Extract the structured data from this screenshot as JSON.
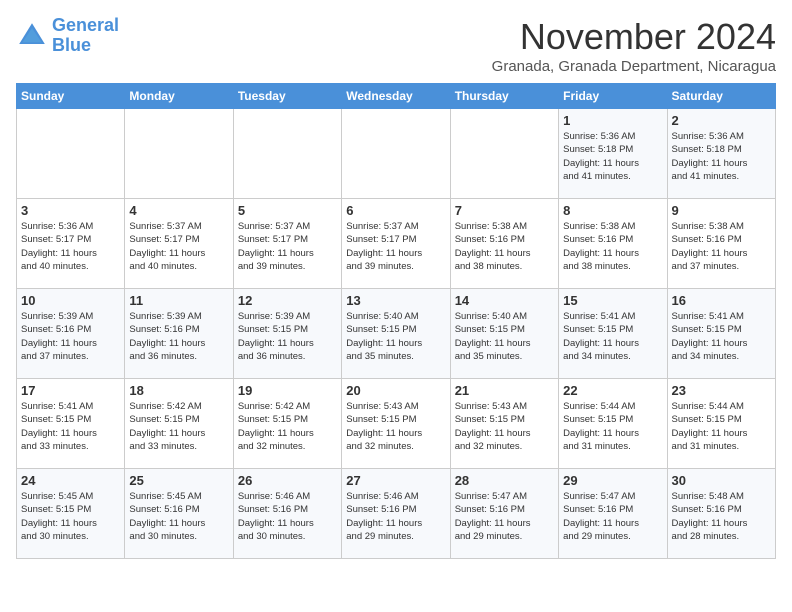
{
  "logo": {
    "line1": "General",
    "line2": "Blue"
  },
  "title": "November 2024",
  "location": "Granada, Granada Department, Nicaragua",
  "days_of_week": [
    "Sunday",
    "Monday",
    "Tuesday",
    "Wednesday",
    "Thursday",
    "Friday",
    "Saturday"
  ],
  "weeks": [
    [
      {
        "day": "",
        "info": ""
      },
      {
        "day": "",
        "info": ""
      },
      {
        "day": "",
        "info": ""
      },
      {
        "day": "",
        "info": ""
      },
      {
        "day": "",
        "info": ""
      },
      {
        "day": "1",
        "info": "Sunrise: 5:36 AM\nSunset: 5:18 PM\nDaylight: 11 hours\nand 41 minutes."
      },
      {
        "day": "2",
        "info": "Sunrise: 5:36 AM\nSunset: 5:18 PM\nDaylight: 11 hours\nand 41 minutes."
      }
    ],
    [
      {
        "day": "3",
        "info": "Sunrise: 5:36 AM\nSunset: 5:17 PM\nDaylight: 11 hours\nand 40 minutes."
      },
      {
        "day": "4",
        "info": "Sunrise: 5:37 AM\nSunset: 5:17 PM\nDaylight: 11 hours\nand 40 minutes."
      },
      {
        "day": "5",
        "info": "Sunrise: 5:37 AM\nSunset: 5:17 PM\nDaylight: 11 hours\nand 39 minutes."
      },
      {
        "day": "6",
        "info": "Sunrise: 5:37 AM\nSunset: 5:17 PM\nDaylight: 11 hours\nand 39 minutes."
      },
      {
        "day": "7",
        "info": "Sunrise: 5:38 AM\nSunset: 5:16 PM\nDaylight: 11 hours\nand 38 minutes."
      },
      {
        "day": "8",
        "info": "Sunrise: 5:38 AM\nSunset: 5:16 PM\nDaylight: 11 hours\nand 38 minutes."
      },
      {
        "day": "9",
        "info": "Sunrise: 5:38 AM\nSunset: 5:16 PM\nDaylight: 11 hours\nand 37 minutes."
      }
    ],
    [
      {
        "day": "10",
        "info": "Sunrise: 5:39 AM\nSunset: 5:16 PM\nDaylight: 11 hours\nand 37 minutes."
      },
      {
        "day": "11",
        "info": "Sunrise: 5:39 AM\nSunset: 5:16 PM\nDaylight: 11 hours\nand 36 minutes."
      },
      {
        "day": "12",
        "info": "Sunrise: 5:39 AM\nSunset: 5:15 PM\nDaylight: 11 hours\nand 36 minutes."
      },
      {
        "day": "13",
        "info": "Sunrise: 5:40 AM\nSunset: 5:15 PM\nDaylight: 11 hours\nand 35 minutes."
      },
      {
        "day": "14",
        "info": "Sunrise: 5:40 AM\nSunset: 5:15 PM\nDaylight: 11 hours\nand 35 minutes."
      },
      {
        "day": "15",
        "info": "Sunrise: 5:41 AM\nSunset: 5:15 PM\nDaylight: 11 hours\nand 34 minutes."
      },
      {
        "day": "16",
        "info": "Sunrise: 5:41 AM\nSunset: 5:15 PM\nDaylight: 11 hours\nand 34 minutes."
      }
    ],
    [
      {
        "day": "17",
        "info": "Sunrise: 5:41 AM\nSunset: 5:15 PM\nDaylight: 11 hours\nand 33 minutes."
      },
      {
        "day": "18",
        "info": "Sunrise: 5:42 AM\nSunset: 5:15 PM\nDaylight: 11 hours\nand 33 minutes."
      },
      {
        "day": "19",
        "info": "Sunrise: 5:42 AM\nSunset: 5:15 PM\nDaylight: 11 hours\nand 32 minutes."
      },
      {
        "day": "20",
        "info": "Sunrise: 5:43 AM\nSunset: 5:15 PM\nDaylight: 11 hours\nand 32 minutes."
      },
      {
        "day": "21",
        "info": "Sunrise: 5:43 AM\nSunset: 5:15 PM\nDaylight: 11 hours\nand 32 minutes."
      },
      {
        "day": "22",
        "info": "Sunrise: 5:44 AM\nSunset: 5:15 PM\nDaylight: 11 hours\nand 31 minutes."
      },
      {
        "day": "23",
        "info": "Sunrise: 5:44 AM\nSunset: 5:15 PM\nDaylight: 11 hours\nand 31 minutes."
      }
    ],
    [
      {
        "day": "24",
        "info": "Sunrise: 5:45 AM\nSunset: 5:15 PM\nDaylight: 11 hours\nand 30 minutes."
      },
      {
        "day": "25",
        "info": "Sunrise: 5:45 AM\nSunset: 5:16 PM\nDaylight: 11 hours\nand 30 minutes."
      },
      {
        "day": "26",
        "info": "Sunrise: 5:46 AM\nSunset: 5:16 PM\nDaylight: 11 hours\nand 30 minutes."
      },
      {
        "day": "27",
        "info": "Sunrise: 5:46 AM\nSunset: 5:16 PM\nDaylight: 11 hours\nand 29 minutes."
      },
      {
        "day": "28",
        "info": "Sunrise: 5:47 AM\nSunset: 5:16 PM\nDaylight: 11 hours\nand 29 minutes."
      },
      {
        "day": "29",
        "info": "Sunrise: 5:47 AM\nSunset: 5:16 PM\nDaylight: 11 hours\nand 29 minutes."
      },
      {
        "day": "30",
        "info": "Sunrise: 5:48 AM\nSunset: 5:16 PM\nDaylight: 11 hours\nand 28 minutes."
      }
    ]
  ]
}
